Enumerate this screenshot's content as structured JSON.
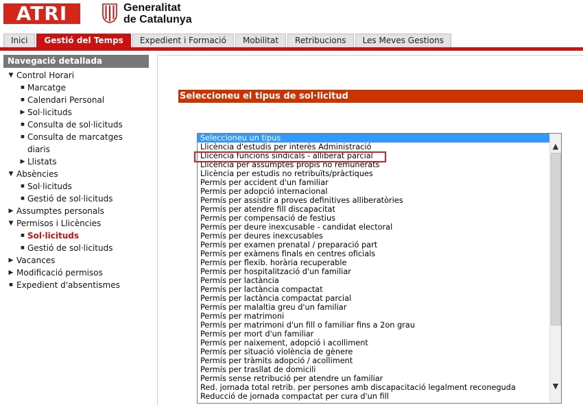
{
  "header": {
    "atri_logo": "ATRI",
    "gencat_line1": "Generalitat",
    "gencat_line2": "de Catalunya"
  },
  "tabs": [
    "Inici",
    "Gestió del Temps",
    "Expedient i Formació",
    "Mobilitat",
    "Retribucions",
    "Les Meves Gestions"
  ],
  "active_tab": "Gestió del Temps",
  "nav": {
    "title": "Navegació detallada",
    "items": [
      {
        "label": "Control Horari",
        "level": 1,
        "icon": "triangle-down"
      },
      {
        "label": "Marcatge",
        "level": 2,
        "icon": "square-bullet"
      },
      {
        "label": "Calendari Personal",
        "level": 2,
        "icon": "square-bullet"
      },
      {
        "label": "Sol·licituds",
        "level": 2,
        "icon": "triangle-right"
      },
      {
        "label": "Consulta de sol·licituds",
        "level": 2,
        "icon": "square-bullet"
      },
      {
        "label": "Consulta de marcatges",
        "level": 2,
        "icon": "square-bullet"
      },
      {
        "label": "diaris",
        "level": 2,
        "icon": "none"
      },
      {
        "label": "Llistats",
        "level": 2,
        "icon": "triangle-right"
      },
      {
        "label": "Absències",
        "level": 1,
        "icon": "triangle-down"
      },
      {
        "label": "Sol·licituds",
        "level": 2,
        "icon": "square-bullet"
      },
      {
        "label": "Gestió de sol·licituds",
        "level": 2,
        "icon": "square-bullet"
      },
      {
        "label": "Assumptes personals",
        "level": 1,
        "icon": "triangle-right"
      },
      {
        "label": "Permisos i Llicències",
        "level": 1,
        "icon": "triangle-down"
      },
      {
        "label": "Sol·licituds",
        "level": 2,
        "icon": "square-bullet",
        "active": true
      },
      {
        "label": "Gestió de sol·licituds",
        "level": 2,
        "icon": "square-bullet"
      },
      {
        "label": "Vacances",
        "level": 1,
        "icon": "triangle-right"
      },
      {
        "label": "Modificació permisos",
        "level": 1,
        "icon": "triangle-right"
      },
      {
        "label": "Expedient d'absentismes",
        "level": 1,
        "icon": "square-bullet"
      }
    ]
  },
  "main": {
    "section_title": "Seleccioneu el tipus de sol·licitud",
    "listbox": {
      "selected_index": 0,
      "highlighted_index": 2,
      "options": [
        "Seleccioneu un tipus",
        "Llicència d'estudis per interès Administració",
        "Llicència funcions sindicals - alliberat parcial",
        "Llicència per assumptes propis no remunerats",
        "Llicència per estudis no retribuïts/pràctiques",
        "Permís per accident d'un familiar",
        "Permís per adopció internacional",
        "Permís per assistir a proves definitives alliberatòries",
        "Permís per atendre fill discapacitat",
        "Permís per compensació de festius",
        "Permís per deure inexcusable - candidat electoral",
        "Permís per deures inexcusables",
        "Permís per examen prenatal / preparació part",
        "Permís per exàmens finals en centres oficials",
        "Permís per flexib. horària recuperable",
        "Permís per hospitalització d'un familiar",
        "Permís per lactància",
        "Permís per lactància compactat",
        "Permís per lactància compactat parcial",
        "Permís per malaltia greu d'un familiar",
        "Permís per matrimoni",
        "Permís per matrimoni d'un fill o familiar fins a 2on grau",
        "Permís per mort d'un familiar",
        "Permís per naixement, adopció i acolliment",
        "Permís per situació violència de gènere",
        "Permís per tràmits adopció / acolliment",
        "Permís per trasllat de domicili",
        "Permís sense retribució per atendre un familiar",
        "Red. jornada total retrib. per persones amb discapacitació legalment reconeguda",
        "Reducció de jornada compactat per cura d'un fill"
      ]
    }
  },
  "colors": {
    "brand_red": "#cc1111",
    "section_orange": "#cc3300",
    "selection_blue": "#3399ff",
    "highlight_border": "#d92020"
  }
}
